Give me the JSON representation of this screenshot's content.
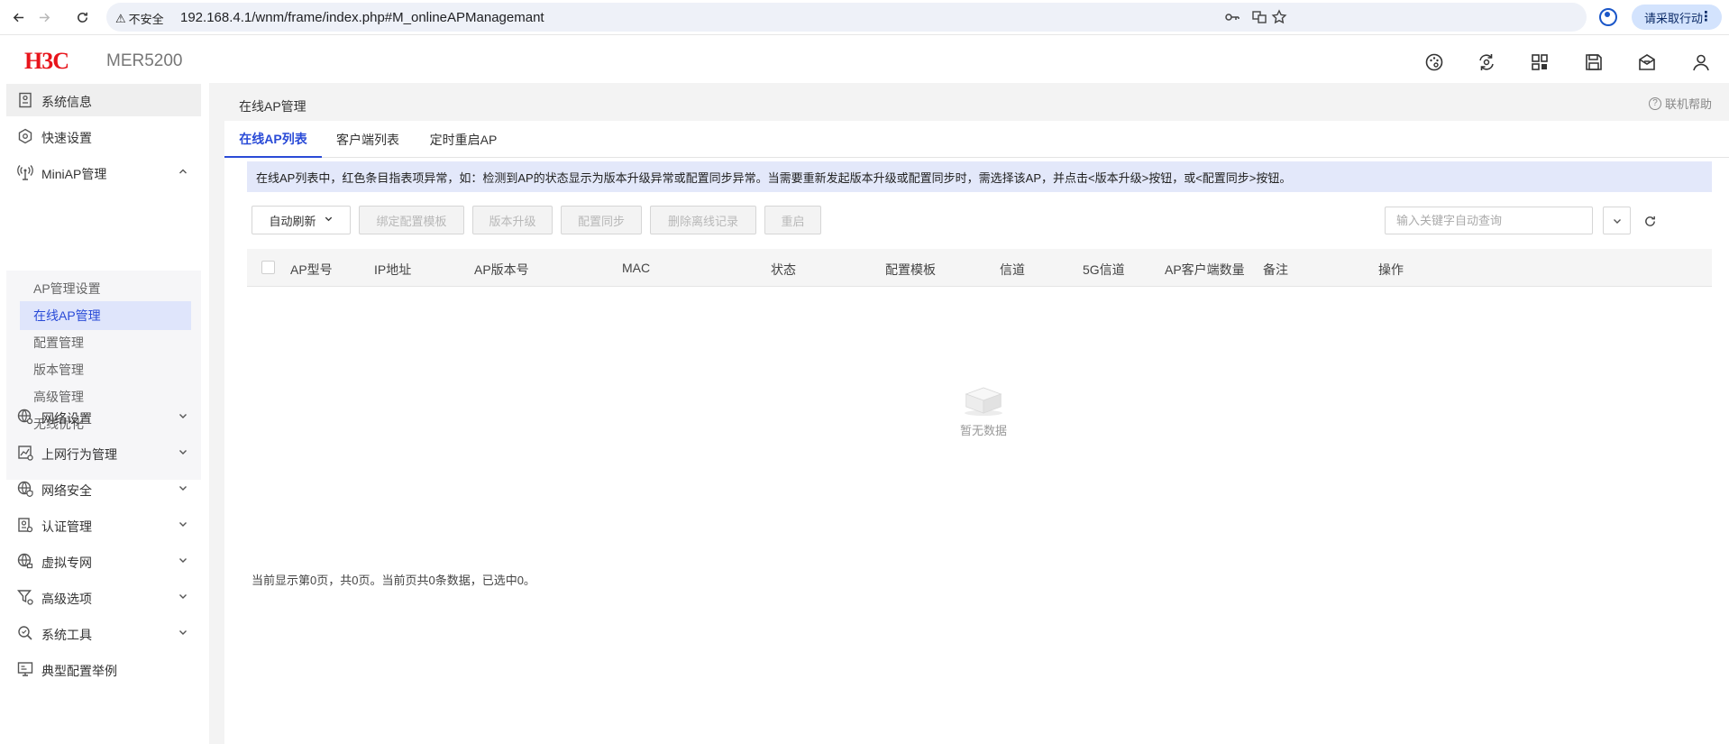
{
  "browser": {
    "security_label": "不安全",
    "url": "192.168.4.1/wnm/frame/index.php#M_onlineAPManagemant",
    "action_label": "请采取行动"
  },
  "header": {
    "logo": "H3C",
    "model": "MER5200"
  },
  "sidebar": {
    "items": [
      {
        "label": "系统信息"
      },
      {
        "label": "快速设置"
      },
      {
        "label": "MiniAP管理"
      },
      {
        "label": "网络设置"
      },
      {
        "label": "上网行为管理"
      },
      {
        "label": "网络安全"
      },
      {
        "label": "认证管理"
      },
      {
        "label": "虚拟专网"
      },
      {
        "label": "高级选项"
      },
      {
        "label": "系统工具"
      },
      {
        "label": "典型配置举例"
      }
    ],
    "submenu": [
      {
        "label": "AP管理设置"
      },
      {
        "label": "在线AP管理"
      },
      {
        "label": "配置管理"
      },
      {
        "label": "版本管理"
      },
      {
        "label": "高级管理"
      },
      {
        "label": "无线优化"
      }
    ]
  },
  "main": {
    "title": "在线AP管理",
    "help": "联机帮助",
    "tabs": [
      {
        "label": "在线AP列表"
      },
      {
        "label": "客户端列表"
      },
      {
        "label": "定时重启AP"
      }
    ],
    "notice": "在线AP列表中，红色条目指表项异常，如：检测到AP的状态显示为版本升级异常或配置同步异常。当需要重新发起版本升级或配置同步时，需选择该AP，并点击<版本升级>按钮，或<配置同步>按钮。",
    "toolbar": {
      "auto_refresh": "自动刷新",
      "bind_template": "绑定配置模板",
      "upgrade": "版本升级",
      "sync": "配置同步",
      "delete_offline": "删除离线记录",
      "restart": "重启",
      "search_placeholder": "输入关键字自动查询"
    },
    "table": {
      "columns": [
        "AP型号",
        "IP地址",
        "AP版本号",
        "MAC",
        "状态",
        "配置模板",
        "信道",
        "5G信道",
        "AP客户端数量",
        "备注",
        "操作"
      ],
      "rows": [],
      "empty_text": "暂无数据"
    },
    "status": "当前显示第0页，共0页。当前页共0条数据，已选中0。"
  }
}
